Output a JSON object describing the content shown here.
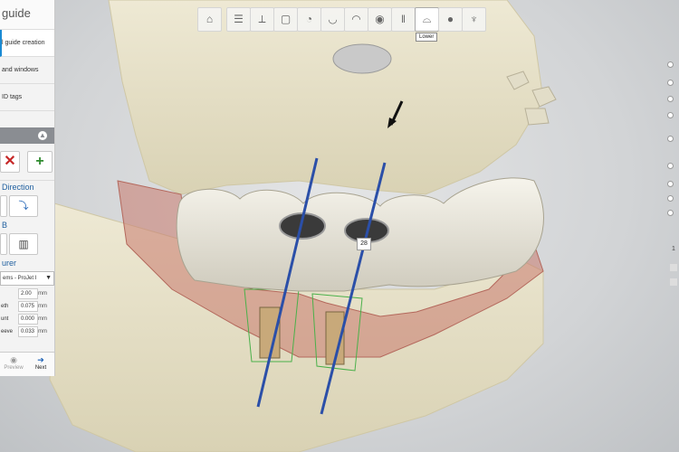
{
  "left_panel": {
    "title": "guide",
    "steps": [
      {
        "label": "l guide creation",
        "active": true
      },
      {
        "label": "and windows",
        "active": false
      },
      {
        "label": "ID tags",
        "active": false
      }
    ],
    "section_direction": "Direction",
    "section_b": "B",
    "section_manufacturer": "urer",
    "manufacturer_select": "ems - ProJet I",
    "params": [
      {
        "label": "",
        "value": "2.00",
        "unit": "mm"
      },
      {
        "label": "eth",
        "value": "0.075",
        "unit": "mm"
      },
      {
        "label": "unt",
        "value": "0.000",
        "unit": "mm"
      },
      {
        "label": "eeve",
        "value": "0.033",
        "unit": "mm"
      }
    ],
    "nav": {
      "preview": "Preview",
      "next": "Next"
    }
  },
  "toolbar": {
    "tooltip": "Lower",
    "buttons": [
      "home-icon",
      "checklist-icon",
      "tree-icon",
      "single-tooth-icon",
      "tooth-scan-icon",
      "lower-jaw-icon",
      "gum-icon",
      "crown-icon",
      "implant-icon",
      "lower-icon",
      "sphere-icon",
      "tooth-outline-icon"
    ],
    "active_index": 9
  },
  "implant_tag": "28",
  "colors": {
    "accent": "#1a8ad3",
    "delete": "#c62828",
    "add": "#2e8b2e",
    "bone": "#e9e3c9",
    "gum": "#c87a6e",
    "crown": "#e6e3d8",
    "pin": "#2b4fa8"
  },
  "right_edge": {
    "top_marker": "1"
  }
}
